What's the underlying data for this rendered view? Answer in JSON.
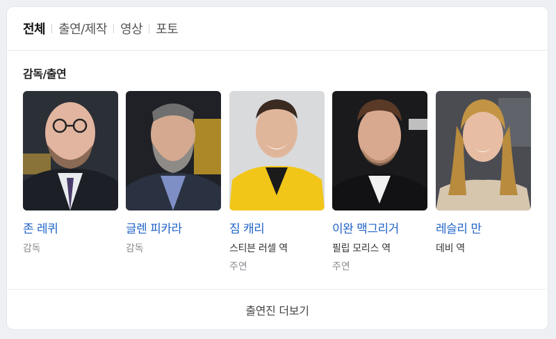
{
  "tabs": [
    {
      "label": "전체",
      "active": true
    },
    {
      "label": "출연/제작",
      "active": false
    },
    {
      "label": "영상",
      "active": false
    },
    {
      "label": "포토",
      "active": false
    }
  ],
  "section_title": "감독/출연",
  "people": [
    {
      "name": "존 레퀴",
      "role": "감독",
      "billing": ""
    },
    {
      "name": "글렌 피카라",
      "role": "감독",
      "billing": ""
    },
    {
      "name": "짐 캐리",
      "role": "스티븐 러셀 역",
      "billing": "주연"
    },
    {
      "name": "이완 맥그리거",
      "role": "필립 모리스 역",
      "billing": "주연"
    },
    {
      "name": "레슬리 만",
      "role": "데비 역",
      "billing": ""
    }
  ],
  "more_label": "출연진 더보기"
}
